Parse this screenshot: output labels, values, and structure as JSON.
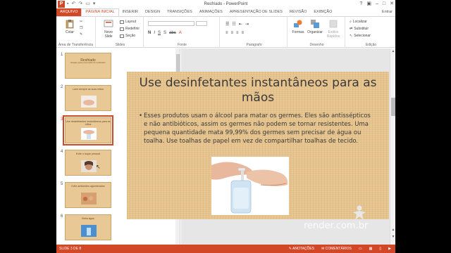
{
  "window": {
    "title": "Resfriado - PowerPoint",
    "user": "Entrar"
  },
  "tabs": [
    "ARQUIVO",
    "PÁGINA INICIAL",
    "INSERIR",
    "DESIGN",
    "TRANSIÇÕES",
    "ANIMAÇÕES",
    "APRESENTAÇÃO DE SLIDES",
    "REVISÃO",
    "EXIBIÇÃO"
  ],
  "ribbon": {
    "clipboard": {
      "paste": "Colar",
      "label": "Área de Transferência"
    },
    "slides": {
      "new_slide": "Novo Slide",
      "layout": "Layout",
      "reset": "Redefinir",
      "section": "Seção",
      "label": "Slides"
    },
    "font": {
      "label": "Fonte"
    },
    "paragraph": {
      "label": "Parágrafo"
    },
    "drawing": {
      "shapes": "Formas",
      "arrange": "Organizar",
      "quick_styles": "Estilos Rápidos",
      "label": "Desenho"
    },
    "editing": {
      "find": "Localizar",
      "replace": "Substituir",
      "select": "Selecionar",
      "label": "Edição"
    }
  },
  "thumbnails": [
    {
      "num": "1",
      "title": "Resfriado",
      "subtitle": "Etapas para prevenção de resfriados",
      "selected": false
    },
    {
      "num": "2",
      "title": "Lave sempre as suas mãos",
      "subtitle": "",
      "selected": false
    },
    {
      "num": "3",
      "title": "Use desinfetantes instantâneos para as mãos",
      "subtitle": "",
      "selected": true
    },
    {
      "num": "4",
      "title": "Evite o toque pessoal",
      "subtitle": "",
      "selected": false
    },
    {
      "num": "5",
      "title": "Evite ambientes aglomerados",
      "subtitle": "",
      "selected": false
    },
    {
      "num": "6",
      "title": "Beba água",
      "subtitle": "",
      "selected": false
    }
  ],
  "slide": {
    "title": "Use desinfetantes instantâneos para as mãos",
    "body": "Esses produtos usam o álcool para matar os germes. Eles são antissépticos e não antibióticos, assim os germes não podem se tornar resistentes. Uma pequena quantidade mata 99,99% dos germes sem precisar de água ou toalha. Use toalhas de papel em vez de compartilhar toalhas de tecido."
  },
  "watermark": "render.com.br",
  "status": {
    "slide": "SLIDE 3 DE 8",
    "notes": "ANOTAÇÕES",
    "comments": "COMENTÁRIOS"
  },
  "colors": {
    "accent": "#d24726",
    "slide_bg": "#e6c38c"
  }
}
